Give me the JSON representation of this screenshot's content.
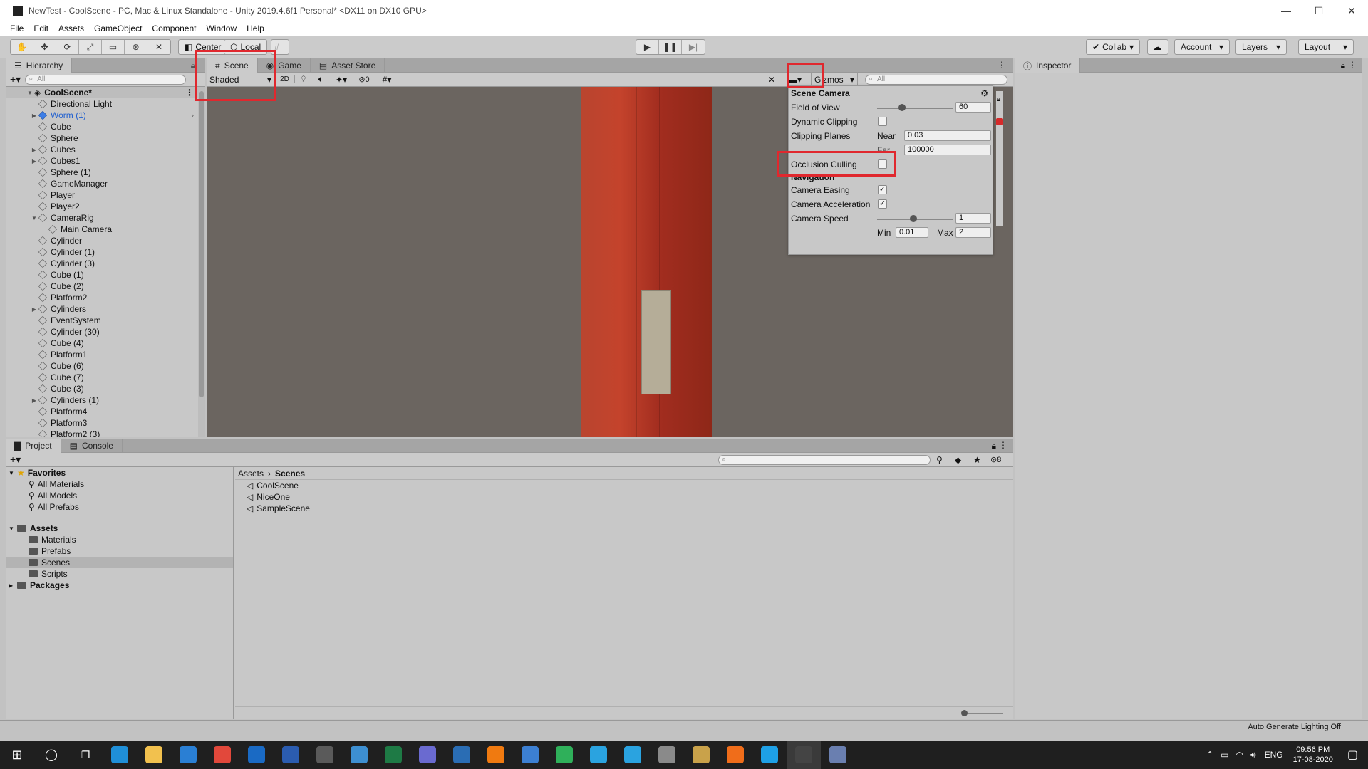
{
  "window": {
    "title": "NewTest - CoolScene - PC, Mac & Linux Standalone - Unity 2019.4.6f1 Personal* <DX11 on DX10 GPU>",
    "controls": [
      "—",
      "☐",
      "✕"
    ]
  },
  "menu": [
    "File",
    "Edit",
    "Assets",
    "GameObject",
    "Component",
    "Window",
    "Help"
  ],
  "toolbar": {
    "pivot": "Center",
    "space": "Local",
    "collab": "Collab",
    "account": "Account",
    "layers": "Layers",
    "layout": "Layout"
  },
  "hierarchy": {
    "tab": "Hierarchy",
    "search_placeholder": "All",
    "scene": "CoolScene*",
    "items": [
      {
        "label": "Directional Light",
        "indent": 2,
        "arrow": ""
      },
      {
        "label": "Worm (1)",
        "indent": 2,
        "arrow": "▶",
        "blue": true
      },
      {
        "label": "Cube",
        "indent": 2,
        "arrow": ""
      },
      {
        "label": "Sphere",
        "indent": 2,
        "arrow": ""
      },
      {
        "label": "Cubes",
        "indent": 2,
        "arrow": "▶"
      },
      {
        "label": "Cubes1",
        "indent": 2,
        "arrow": "▶"
      },
      {
        "label": "Sphere (1)",
        "indent": 2,
        "arrow": ""
      },
      {
        "label": "GameManager",
        "indent": 2,
        "arrow": ""
      },
      {
        "label": "Player",
        "indent": 2,
        "arrow": ""
      },
      {
        "label": "Player2",
        "indent": 2,
        "arrow": ""
      },
      {
        "label": "CameraRig",
        "indent": 2,
        "arrow": "▼"
      },
      {
        "label": "Main Camera",
        "indent": 3,
        "arrow": ""
      },
      {
        "label": "Cylinder",
        "indent": 2,
        "arrow": ""
      },
      {
        "label": "Cylinder (1)",
        "indent": 2,
        "arrow": ""
      },
      {
        "label": "Cylinder (3)",
        "indent": 2,
        "arrow": ""
      },
      {
        "label": "Cube (1)",
        "indent": 2,
        "arrow": ""
      },
      {
        "label": "Cube (2)",
        "indent": 2,
        "arrow": ""
      },
      {
        "label": "Platform2",
        "indent": 2,
        "arrow": ""
      },
      {
        "label": "Cylinders",
        "indent": 2,
        "arrow": "▶"
      },
      {
        "label": "EventSystem",
        "indent": 2,
        "arrow": ""
      },
      {
        "label": "Cylinder (30)",
        "indent": 2,
        "arrow": ""
      },
      {
        "label": "Cube (4)",
        "indent": 2,
        "arrow": ""
      },
      {
        "label": "Platform1",
        "indent": 2,
        "arrow": ""
      },
      {
        "label": "Cube (6)",
        "indent": 2,
        "arrow": ""
      },
      {
        "label": "Cube (7)",
        "indent": 2,
        "arrow": ""
      },
      {
        "label": "Cube (3)",
        "indent": 2,
        "arrow": ""
      },
      {
        "label": "Cylinders (1)",
        "indent": 2,
        "arrow": "▶"
      },
      {
        "label": "Platform4",
        "indent": 2,
        "arrow": ""
      },
      {
        "label": "Platform3",
        "indent": 2,
        "arrow": ""
      },
      {
        "label": "Platform2 (3)",
        "indent": 2,
        "arrow": ""
      }
    ]
  },
  "scene_view": {
    "tabs": [
      "Scene",
      "Game",
      "Asset Store"
    ],
    "shading_mode": "Shaded",
    "mode_2d": "2D",
    "hidden_count": "0",
    "gizmos": "Gizmos",
    "search_placeholder": "All"
  },
  "scene_camera": {
    "title": "Scene Camera",
    "field_of_view_label": "Field of View",
    "field_of_view": "60",
    "field_of_view_fraction": 0.33,
    "dynamic_clipping_label": "Dynamic Clipping",
    "dynamic_clipping": false,
    "clipping_planes_label": "Clipping Planes",
    "near_label": "Near",
    "near": "0.03",
    "far_label": "Far",
    "far": "100000",
    "occlusion_culling_label": "Occlusion Culling",
    "occlusion_culling": false,
    "navigation_title": "Navigation",
    "camera_easing_label": "Camera Easing",
    "camera_easing": true,
    "camera_acceleration_label": "Camera Acceleration",
    "camera_acceleration": true,
    "camera_speed_label": "Camera Speed",
    "camera_speed": "1",
    "camera_speed_fraction": 0.48,
    "min_label": "Min",
    "min": "0.01",
    "max_label": "Max",
    "max": "2"
  },
  "inspector": {
    "tab": "Inspector"
  },
  "project": {
    "tabs": [
      "Project",
      "Console"
    ],
    "hidden_count": "8",
    "favorites_label": "Favorites",
    "favorites": [
      "All Materials",
      "All Models",
      "All Prefabs"
    ],
    "assets_label": "Assets",
    "assets_folders": [
      "Materials",
      "Prefabs",
      "Scenes",
      "Scripts"
    ],
    "packages_label": "Packages",
    "breadcrumb": [
      "Assets",
      "Scenes"
    ],
    "files": [
      "CoolScene",
      "NiceOne",
      "SampleScene"
    ]
  },
  "status": {
    "lighting": "Auto Generate Lighting Off"
  },
  "taskbar": {
    "language": "ENG",
    "time": "09:56 PM",
    "date": "17-08-2020",
    "apps": [
      {
        "name": "edge-icon",
        "color": "#1f8fd8"
      },
      {
        "name": "file-explorer-icon",
        "color": "#f2c14e"
      },
      {
        "name": "mail-icon",
        "color": "#2a7fd4"
      },
      {
        "name": "chrome-icon",
        "color": "#e2483b"
      },
      {
        "name": "outlook-icon",
        "color": "#1a6ac4"
      },
      {
        "name": "word-icon",
        "color": "#2b5cb0"
      },
      {
        "name": "calculator-icon",
        "color": "#5a5a5a"
      },
      {
        "name": "paint-icon",
        "color": "#3d8fd1"
      },
      {
        "name": "excel-icon",
        "color": "#1e7a45"
      },
      {
        "name": "network-icon",
        "color": "#6a6ad0"
      },
      {
        "name": "vscode-icon",
        "color": "#2a6db4"
      },
      {
        "name": "vlc-icon",
        "color": "#f07a10"
      },
      {
        "name": "qbittorrent-icon",
        "color": "#3c7fd2"
      },
      {
        "name": "maps-icon",
        "color": "#2fb05a"
      },
      {
        "name": "telegram-icon",
        "color": "#2aa3e0"
      },
      {
        "name": "telegram2-icon",
        "color": "#2aa3e0"
      },
      {
        "name": "database-icon",
        "color": "#8a8a8a"
      },
      {
        "name": "box-icon",
        "color": "#c9a24a"
      },
      {
        "name": "avast-icon",
        "color": "#f06d1a"
      },
      {
        "name": "skype-icon",
        "color": "#1ea0e6"
      },
      {
        "name": "unity-icon",
        "color": "#444444"
      },
      {
        "name": "editor-icon",
        "color": "#6a7fb0"
      }
    ]
  }
}
